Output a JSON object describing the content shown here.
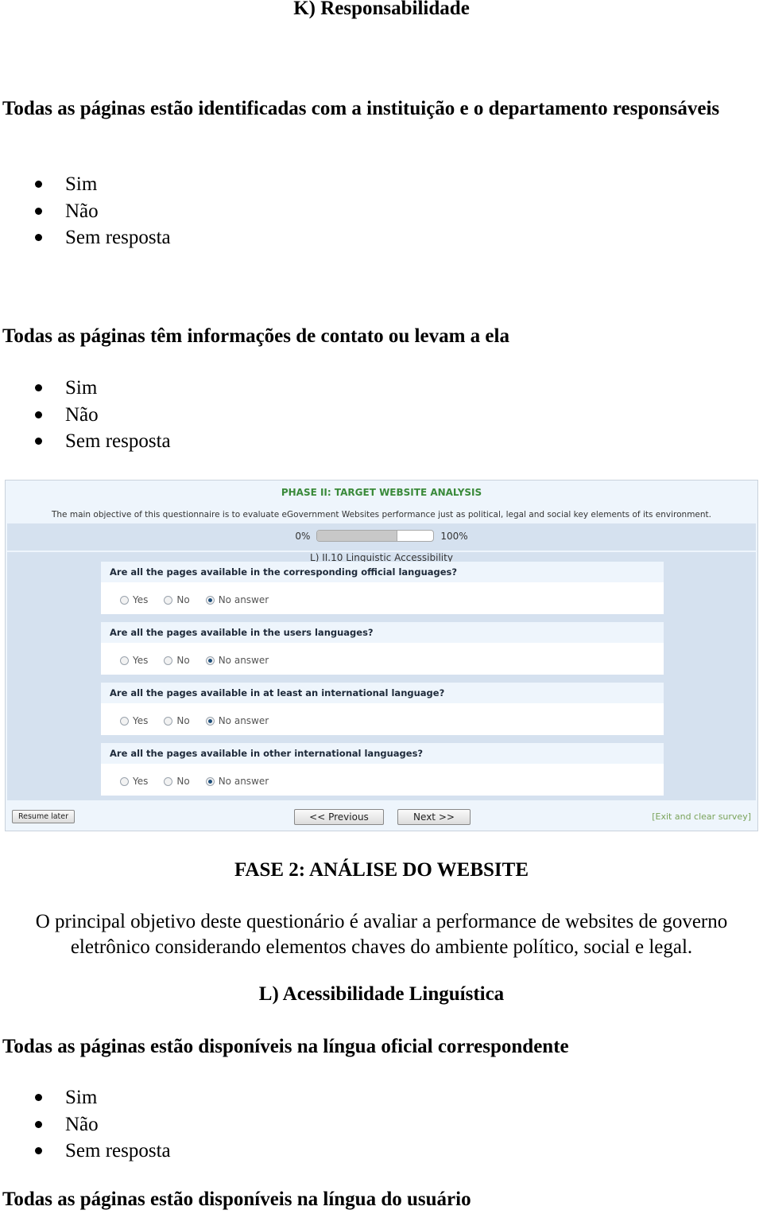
{
  "section_k": {
    "title": "K) Responsabilidade",
    "questions": [
      {
        "text": "Todas as páginas estão identificadas com a instituição e o departamento responsáveis",
        "options": [
          "Sim",
          "Não",
          "Sem resposta"
        ]
      },
      {
        "text": "Todas as páginas têm informações de contato ou levam a ela",
        "options": [
          "Sim",
          "Não",
          "Sem resposta"
        ]
      }
    ]
  },
  "survey": {
    "title": "PHASE II: TARGET WEBSITE ANALYSIS",
    "description": "The main objective of this questionnaire is to evaluate eGovernment Websites performance just as political, legal and social key elements of its environment.",
    "progress": {
      "min_label": "0%",
      "max_label": "100%",
      "value_percent": 69
    },
    "section_title": "L) II.10 Linguistic Accessibility",
    "questions": [
      {
        "text": "Are all the pages available in the corresponding official languages?",
        "options": [
          "Yes",
          "No",
          "No answer"
        ],
        "selected": "No answer"
      },
      {
        "text": "Are all the pages available in the users languages?",
        "options": [
          "Yes",
          "No",
          "No answer"
        ],
        "selected": "No answer"
      },
      {
        "text": "Are all the pages available in at least an international language?",
        "options": [
          "Yes",
          "No",
          "No answer"
        ],
        "selected": "No answer"
      },
      {
        "text": "Are all the pages available in other international languages?",
        "options": [
          "Yes",
          "No",
          "No answer"
        ],
        "selected": "No answer"
      }
    ],
    "buttons": {
      "resume_later": "Resume later",
      "previous": "<< Previous",
      "next": "Next >>",
      "exit": "[Exit and clear survey]"
    }
  },
  "phase2": {
    "title": "FASE 2: ANÁLISE DO WEBSITE",
    "description": "O principal objetivo deste questionário é avaliar a performance de websites de governo eletrônico considerando elementos chaves do ambiente político, social e legal."
  },
  "section_l": {
    "title": "L) Acessibilidade Linguística",
    "questions": [
      {
        "text": "Todas as páginas estão disponíveis na língua oficial correspondente",
        "options": [
          "Sim",
          "Não",
          "Sem resposta"
        ]
      },
      {
        "text": "Todas as páginas estão disponíveis na língua do usuário",
        "options": []
      }
    ]
  }
}
